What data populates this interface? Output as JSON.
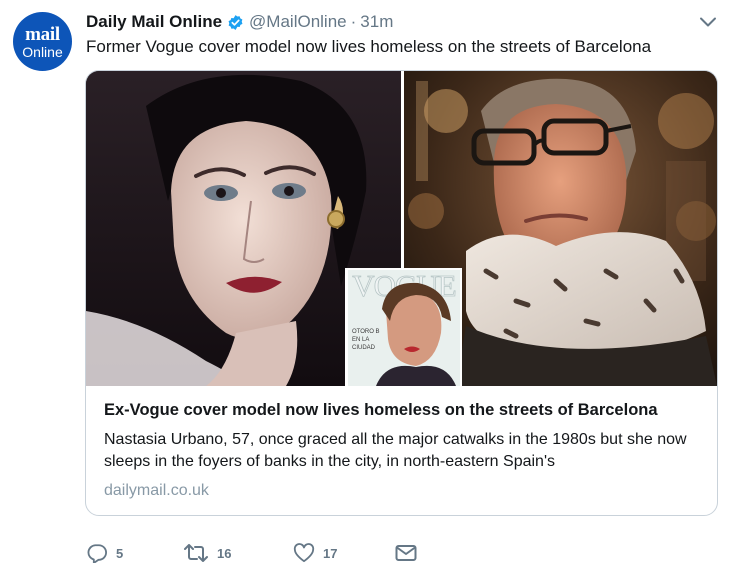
{
  "account": {
    "avatar_line1": "mail",
    "avatar_line2": "Online",
    "name": "Daily Mail Online",
    "handle": "@MailOnline",
    "separator": "·",
    "time": "31m"
  },
  "tweet": {
    "text": "Former Vogue cover model now lives homeless on the streets of Barcelona"
  },
  "card": {
    "magazine_masthead": "VOGUE",
    "magazine_cover_lines": [
      "OTORO B",
      "EN LA",
      "CIUDAD"
    ],
    "title": "Ex-Vogue cover model now lives homeless on the streets of Barcelona",
    "description": "Nastasia Urbano, 57, once graced all the major catwalks in the 1980s but she now sleeps in the foyers of banks in the city, in north-eastern Spain's",
    "domain": "dailymail.co.uk"
  },
  "actions": {
    "reply_count": "5",
    "retweet_count": "16",
    "like_count": "17"
  },
  "colors": {
    "avatar_bg": "#0d55b8",
    "verified": "#1da1f2",
    "muted": "#657786",
    "domain": "#8899a6",
    "card_border": "#c9d2da"
  },
  "icons": [
    "verified-badge-icon",
    "chevron-down-icon",
    "reply-icon",
    "retweet-icon",
    "like-heart-icon",
    "direct-message-envelope-icon"
  ]
}
